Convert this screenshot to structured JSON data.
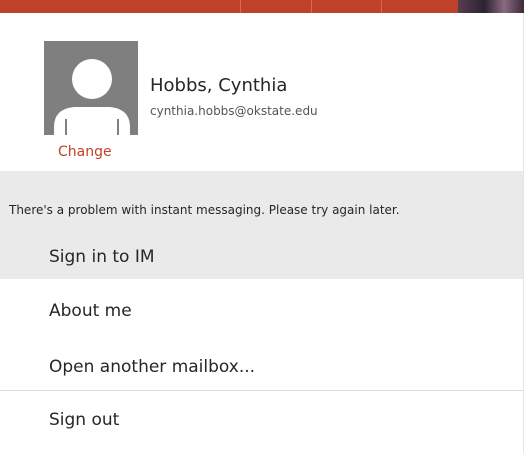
{
  "profile": {
    "name": "Hobbs, Cynthia",
    "email": "cynthia.hobbs@okstate.edu",
    "change_label": "Change"
  },
  "alert": {
    "message": "There's a problem with instant messaging. Please try again later."
  },
  "menu": {
    "sign_in_im": "Sign in to IM",
    "about_me": "About me",
    "open_another_mailbox": "Open another mailbox...",
    "sign_out": "Sign out"
  },
  "colors": {
    "accent": "#c0412a",
    "alert_background": "#eaeaea",
    "avatar_background": "#7f7f7f"
  },
  "icons": {
    "avatar": "person-silhouette-icon"
  }
}
